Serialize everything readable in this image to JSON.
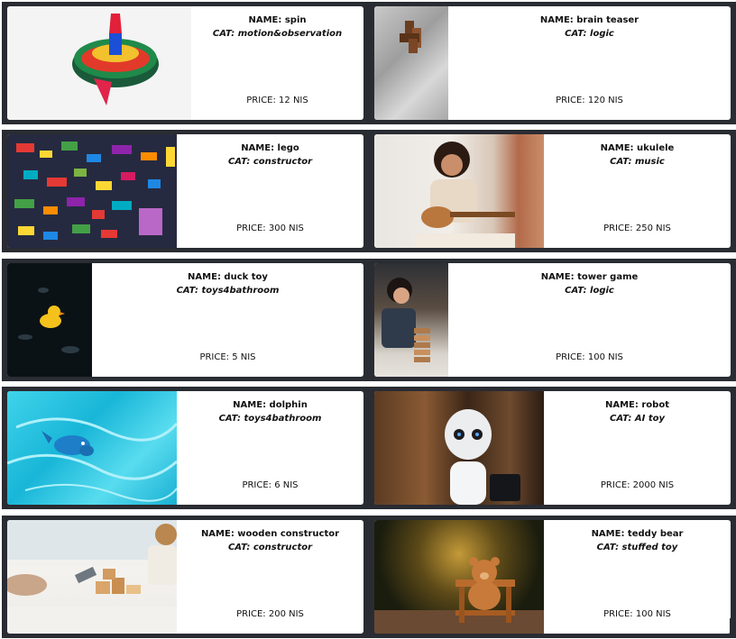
{
  "labels": {
    "name_prefix": "NAME: ",
    "cat_prefix": "CAT: ",
    "price_prefix": "PRICE: "
  },
  "products": [
    {
      "name": "NAME: spin",
      "category": "CAT: motion&observation",
      "price": "PRICE: 12 NIS",
      "image": "spinning-top-toy-image"
    },
    {
      "name": "NAME: brain teaser",
      "category": "CAT: logic",
      "price": "PRICE: 120 NIS",
      "image": "wooden-brain-teaser-image"
    },
    {
      "name": "NAME: lego",
      "category": "CAT: constructor",
      "price": "PRICE: 300 NIS",
      "image": "lego-bricks-image"
    },
    {
      "name": "NAME: ukulele",
      "category": "CAT: music",
      "price": "PRICE: 250 NIS",
      "image": "girl-playing-ukulele-image"
    },
    {
      "name": "NAME: duck toy",
      "category": "CAT: toys4bathroom",
      "price": "PRICE: 5 NIS",
      "image": "rubber-duck-image"
    },
    {
      "name": "NAME: tower game",
      "category": "CAT: logic",
      "price": "PRICE: 100 NIS",
      "image": "child-tower-game-image"
    },
    {
      "name": "NAME: dolphin",
      "category": "CAT: toys4bathroom",
      "price": "PRICE: 6 NIS",
      "image": "dolphin-toy-pool-image"
    },
    {
      "name": "NAME: robot",
      "category": "CAT: AI toy",
      "price": "PRICE: 2000 NIS",
      "image": "humanoid-robot-image"
    },
    {
      "name": "NAME: wooden constructor",
      "category": "CAT: constructor",
      "price": "PRICE: 200 NIS",
      "image": "wooden-blocks-child-image"
    },
    {
      "name": "NAME: teddy bear",
      "category": "CAT: stuffed toy",
      "price": "PRICE: 100 NIS",
      "image": "teddy-bear-bench-image"
    }
  ],
  "colors": {
    "card_frame": "#2a2c33",
    "card_bg": "#ffffff",
    "text": "#111111"
  }
}
